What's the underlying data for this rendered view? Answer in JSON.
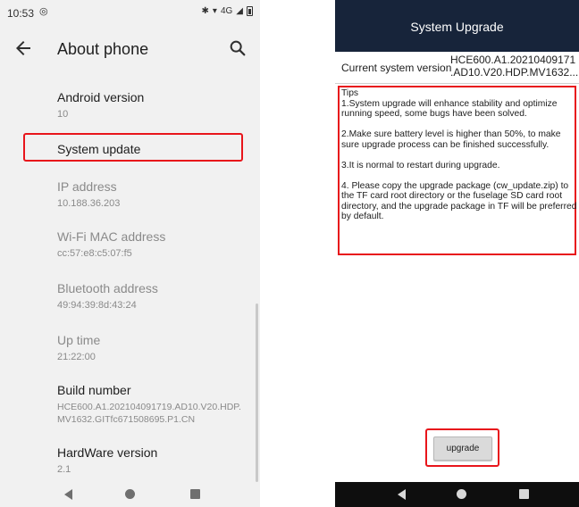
{
  "left": {
    "status": {
      "time": "10:53",
      "network": "4G"
    },
    "appbar": {
      "title": "About phone"
    },
    "items": [
      {
        "title": "Android version",
        "sub": "10"
      },
      {
        "title": "System update",
        "sub": ""
      },
      {
        "title": "IP address",
        "sub": "10.188.36.203"
      },
      {
        "title": "Wi-Fi MAC address",
        "sub": "cc:57:e8:c5:07:f5"
      },
      {
        "title": "Bluetooth address",
        "sub": "49:94:39:8d:43:24"
      },
      {
        "title": "Up time",
        "sub": "21:22:00"
      },
      {
        "title": "Build number",
        "sub": "HCE600.A1.202104091719.AD10.V20.HDP.\nMV1632.GITfc671508695.P1.CN"
      },
      {
        "title": "HardWare version",
        "sub": "2.1"
      }
    ]
  },
  "right": {
    "header_title": "System Upgrade",
    "current_label": "Current system version",
    "current_value": "HCE600.A1.20210409171\n.AD10.V20.HDP.MV1632...",
    "tips": [
      "Tips",
      "1.System upgrade will enhance stability and optimize running speed, some bugs have been solved.",
      "2.Make sure battery level is higher than 50%, to make sure upgrade process can be finished successfully.",
      "3.It is normal to restart during upgrade.",
      "4. Please copy the upgrade package (cw_update.zip) to the TF card root directory or the fuselage SD card root directory, and the upgrade package in TF will be preferred by default."
    ],
    "upgrade_button": "upgrade"
  },
  "colors": {
    "highlight": "#e8151b",
    "header_bg": "#17243a",
    "panel_bg": "#f1f1f1"
  }
}
